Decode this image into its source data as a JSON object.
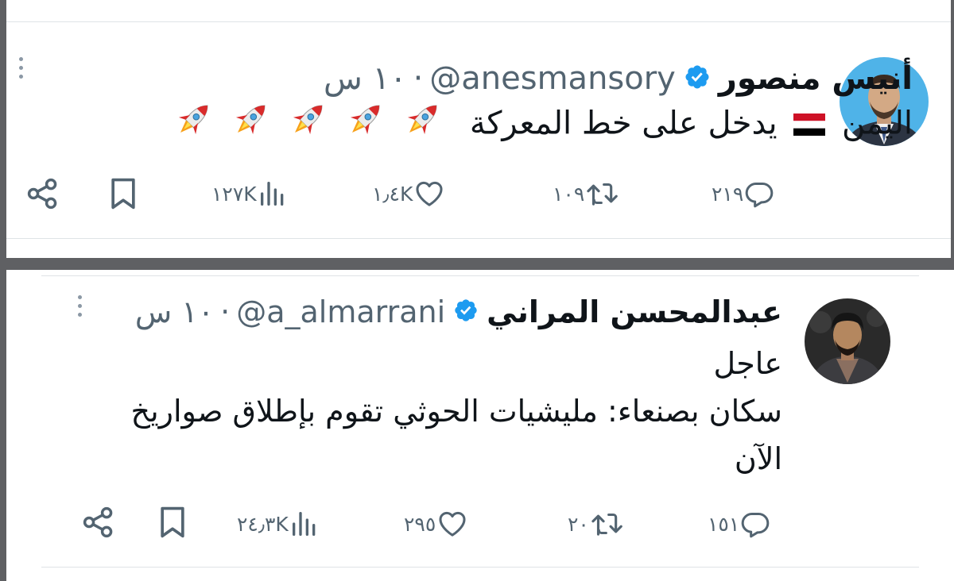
{
  "tweets": [
    {
      "name": "أنيس منصور",
      "handle": "@anesmansory",
      "separator": "·",
      "time": "١٠ س",
      "text_lines": [
        "اليمن 🇾🇪 يدخل على خط المعركة 🚀🚀🚀🚀🚀"
      ],
      "text_parts": {
        "before_flag": "اليمن",
        "after_flag": "يدخل على خط المعركة"
      },
      "rocket_count": 5,
      "stats": {
        "replies": "٢١٩",
        "retweets": "١٠٩",
        "likes": "١٫٤K",
        "views": "١٢٧K"
      }
    },
    {
      "name": "عبدالمحسن المراني",
      "handle": "@a_almarrani",
      "separator": "·",
      "time": "١٠ س",
      "text_lines": [
        "عاجل",
        "سكان بصنعاء: مليشيات الحوثي تقوم بإطلاق صواريخ",
        "الآن"
      ],
      "stats": {
        "replies": "١٥١",
        "retweets": "٢٠",
        "likes": "٢٩٥",
        "views": "٢٤٫٣K"
      }
    }
  ],
  "colors": {
    "verified": "#1d9bf0",
    "avatar1_bg": "#4fb3e8",
    "avatar2_bg": "#2a2a2a",
    "muted": "#536471",
    "text": "#0f1419",
    "separator_band": "#5f6063"
  },
  "icons": {
    "reply": "reply-icon",
    "retweet": "retweet-icon",
    "like": "heart-icon",
    "views": "views-icon",
    "bookmark": "bookmark-icon",
    "share": "share-icon",
    "more": "more-icon",
    "verified": "verified-badge-icon",
    "flag": "yemen-flag-icon",
    "rocket": "rocket-icon"
  }
}
